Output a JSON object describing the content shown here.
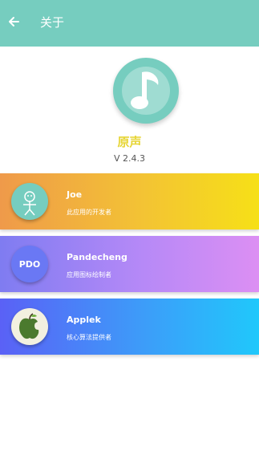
{
  "toolbar": {
    "title": "关于",
    "back_icon": "arrow-left-icon",
    "color": "#76cdbf"
  },
  "app": {
    "name": "原声",
    "version": "V 2.4.3",
    "logo_icon": "music-note-icon"
  },
  "credits": [
    {
      "name": "Joe",
      "role": "此应用的开发者",
      "avatar_icon": "stick-figure-icon"
    },
    {
      "name": "Pandecheng",
      "role": "应用图标绘制者",
      "avatar_icon": "pdo-badge-icon",
      "avatar_text": "PDO"
    },
    {
      "name": "Applek",
      "role": "核心算法提供者",
      "avatar_icon": "bitten-apple-icon"
    }
  ]
}
